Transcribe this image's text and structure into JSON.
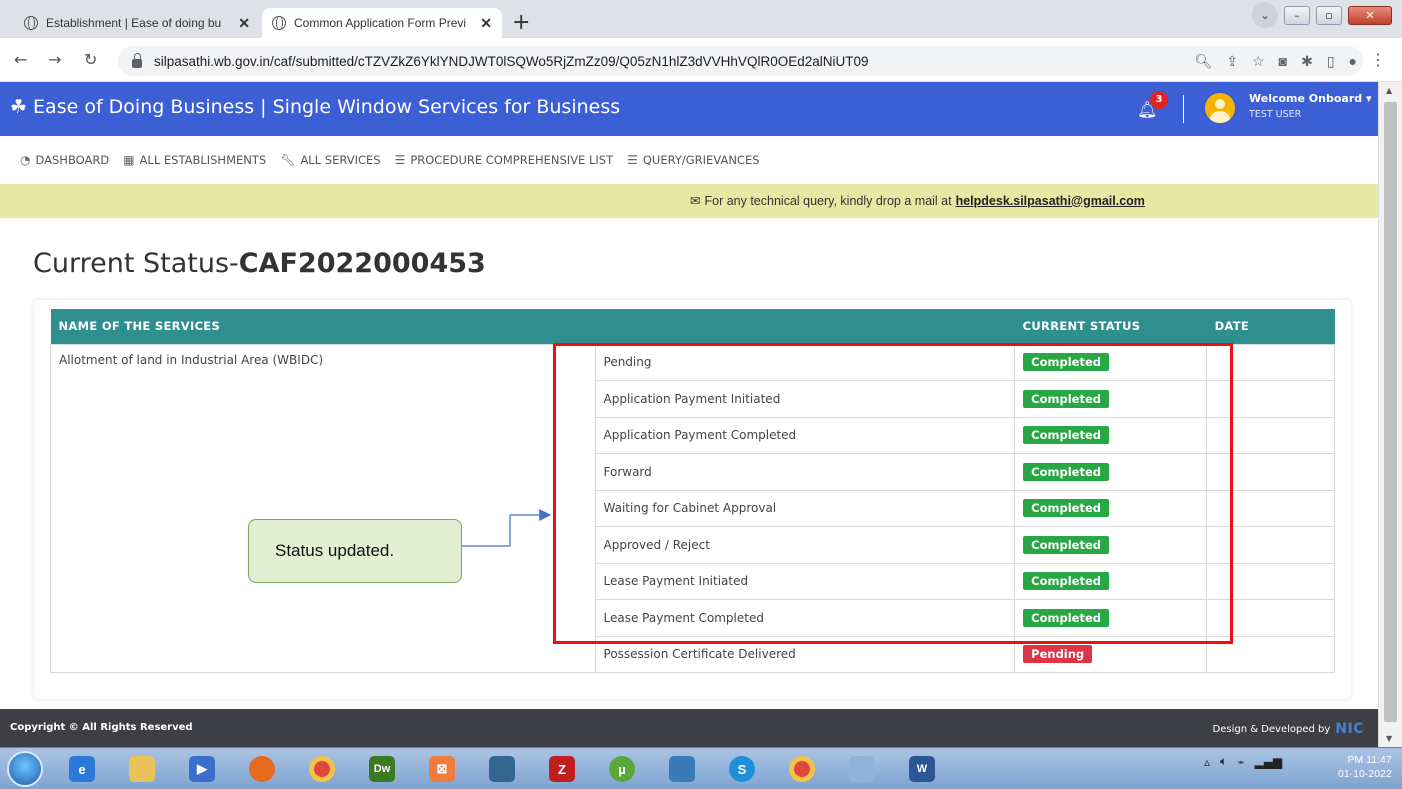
{
  "browser": {
    "tabs": [
      {
        "title": "Establishment | Ease of doing bu"
      },
      {
        "title": "Common Application Form Previ"
      }
    ],
    "new_tab": "+",
    "url": "silpasathi.wb.gov.in/caf/submitted/cTZVZkZ6YklYNDJWT0lSQWo5RjZmZz09/Q05zN1hlZ3dVVHhVQlR0OEd2alNiUT09"
  },
  "header": {
    "title": "Ease of Doing Business | Single Window Services for Business",
    "notification_count": "3",
    "welcome": "Welcome Onboard",
    "user": "TEST USER"
  },
  "nav": [
    {
      "label": "DASHBOARD"
    },
    {
      "label": "ALL ESTABLISHMENTS"
    },
    {
      "label": "ALL SERVICES"
    },
    {
      "label": "PROCEDURE COMPREHENSIVE LIST"
    },
    {
      "label": "QUERY/GRIEVANCES"
    }
  ],
  "notice": {
    "text": "For any technical query, kindly drop a mail at",
    "email": "helpdesk.silpasathi@gmail.com"
  },
  "page": {
    "title_prefix": "Current Status-",
    "caf_id": "CAF2022000453"
  },
  "table": {
    "headers": [
      "NAME OF THE SERVICES",
      "",
      "CURRENT STATUS",
      "DATE"
    ],
    "service_name": "Allotment of land in Industrial Area (WBIDC)",
    "steps": [
      {
        "stage": "Pending",
        "status": "Completed",
        "date": ""
      },
      {
        "stage": "Application Payment Initiated",
        "status": "Completed",
        "date": ""
      },
      {
        "stage": "Application Payment Completed",
        "status": "Completed",
        "date": ""
      },
      {
        "stage": "Forward",
        "status": "Completed",
        "date": ""
      },
      {
        "stage": "Waiting for Cabinet Approval",
        "status": "Completed",
        "date": ""
      },
      {
        "stage": "Approved / Reject",
        "status": "Completed",
        "date": ""
      },
      {
        "stage": "Lease Payment Initiated",
        "status": "Completed",
        "date": ""
      },
      {
        "stage": "Lease Payment Completed",
        "status": "Completed",
        "date": ""
      },
      {
        "stage": "Possession Certificate Delivered",
        "status": "Pending",
        "date": ""
      }
    ]
  },
  "annotation": {
    "callout": "Status updated."
  },
  "footer": {
    "copyright": "Copyright © All Rights Reserved",
    "designed_by": "Design & Developed by",
    "logo": "NIC"
  },
  "taskbar": {
    "time": "PM 11:47",
    "date": "01-10-2022"
  },
  "colors": {
    "header_blue": "#3d5fd6",
    "table_header_teal": "#2f8e8e",
    "completed_green": "#28a745",
    "pending_red": "#dc3545",
    "annotation_red": "#ee1111"
  }
}
